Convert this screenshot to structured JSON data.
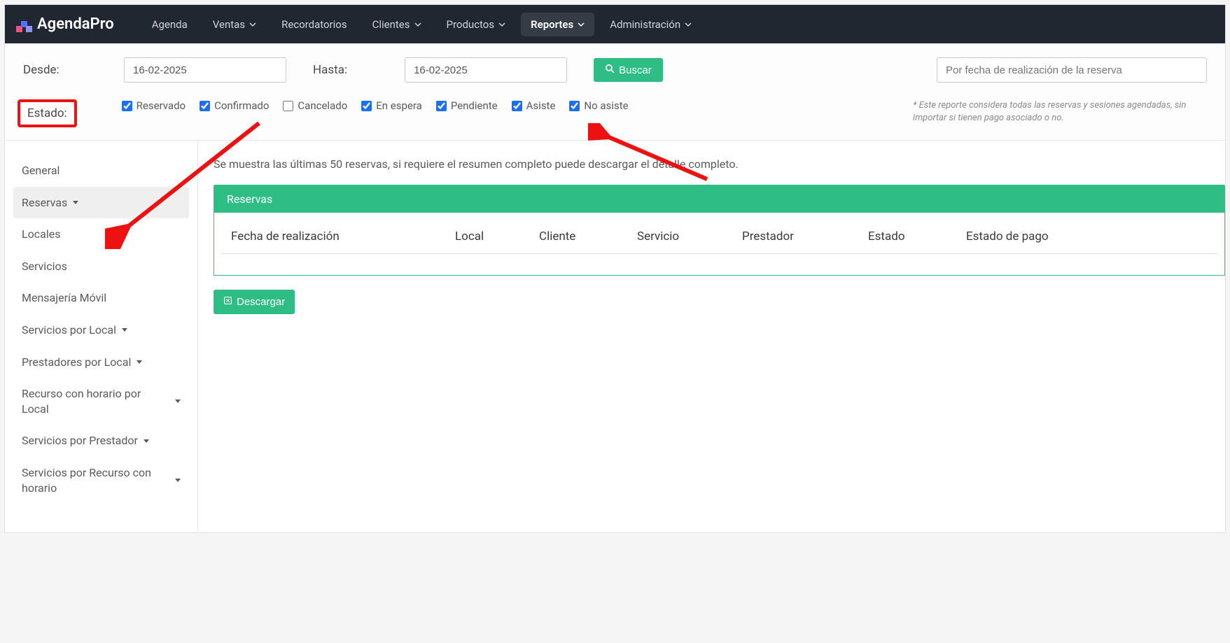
{
  "brand": {
    "name": "AgendaPro"
  },
  "nav": {
    "items": [
      {
        "label": "Agenda",
        "dropdown": false,
        "active": false
      },
      {
        "label": "Ventas",
        "dropdown": true,
        "active": false
      },
      {
        "label": "Recordatorios",
        "dropdown": false,
        "active": false
      },
      {
        "label": "Clientes",
        "dropdown": true,
        "active": false
      },
      {
        "label": "Productos",
        "dropdown": true,
        "active": false
      },
      {
        "label": "Reportes",
        "dropdown": true,
        "active": true
      },
      {
        "label": "Administración",
        "dropdown": true,
        "active": false
      }
    ]
  },
  "filters": {
    "desde_label": "Desde:",
    "desde_value": "16-02-2025",
    "hasta_label": "Hasta:",
    "hasta_value": "16-02-2025",
    "buscar_label": "Buscar",
    "search_placeholder": "Por fecha de realización de la reserva",
    "estado_label": "Estado:",
    "estados": [
      {
        "label": "Reservado",
        "checked": true
      },
      {
        "label": "Confirmado",
        "checked": true
      },
      {
        "label": "Cancelado",
        "checked": false
      },
      {
        "label": "En espera",
        "checked": true
      },
      {
        "label": "Pendiente",
        "checked": true
      },
      {
        "label": "Asiste",
        "checked": true
      },
      {
        "label": "No asiste",
        "checked": true
      }
    ],
    "note": "* Este reporte considera todas las reservas y sesiones agendadas, sin importar si tienen pago asociado o no."
  },
  "sidebar": {
    "items": [
      {
        "label": "General",
        "dropdown": false,
        "active": false
      },
      {
        "label": "Reservas",
        "dropdown": true,
        "active": true
      },
      {
        "label": "Locales",
        "dropdown": false,
        "active": false
      },
      {
        "label": "Servicios",
        "dropdown": false,
        "active": false
      },
      {
        "label": "Mensajería Móvil",
        "dropdown": false,
        "active": false
      },
      {
        "label": "Servicios por Local",
        "dropdown": true,
        "active": false
      },
      {
        "label": "Prestadores por Local",
        "dropdown": true,
        "active": false
      },
      {
        "label": "Recurso con horario por Local",
        "dropdown": true,
        "active": false
      },
      {
        "label": "Servicios por Prestador",
        "dropdown": true,
        "active": false
      },
      {
        "label": "Servicios por Recurso con horario",
        "dropdown": true,
        "active": false
      }
    ]
  },
  "main": {
    "info_text": "Se muestra las últimas 50 reservas, si requiere el resumen completo puede descargar el detalle completo.",
    "panel_title": "Reservas",
    "columns": [
      "Fecha de realización",
      "Local",
      "Cliente",
      "Servicio",
      "Prestador",
      "Estado",
      "Estado de pago"
    ],
    "download_label": "Descargar"
  },
  "colors": {
    "green": "#2ebd85",
    "navbg": "#212730",
    "red": "#e11"
  }
}
